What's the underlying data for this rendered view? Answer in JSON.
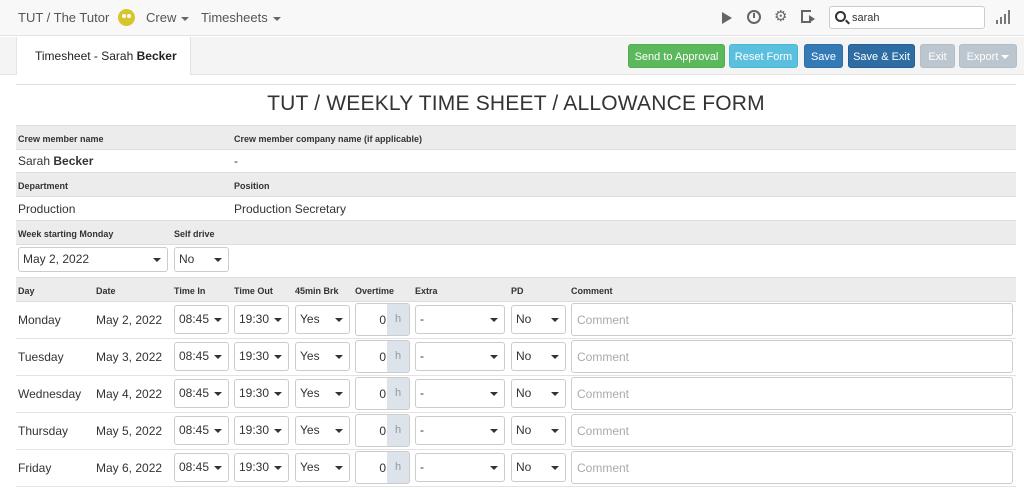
{
  "nav": {
    "brand": "TUT / The Tutor",
    "crew_label": "Crew",
    "timesheets_label": "Timesheets",
    "search_value": "sarah"
  },
  "subheader": {
    "title_prefix": "Timesheet - Sarah ",
    "title_bold": "Becker",
    "buttons": {
      "approval": "Send to Approval",
      "reset": "Reset Form",
      "save": "Save",
      "save_exit": "Save & Exit",
      "exit": "Exit",
      "export": "Export"
    }
  },
  "form": {
    "title": "TUT / WEEKLY TIME SHEET / ALLOWANCE FORM",
    "labels": {
      "crew_name": "Crew member name",
      "company": "Crew member company name (if applicable)",
      "department": "Department",
      "position": "Position",
      "week_start": "Week starting Monday",
      "self_drive": "Self drive"
    },
    "crew_first": "Sarah ",
    "crew_last": "Becker",
    "company": "-",
    "department": "Production",
    "position": "Production Secretary",
    "week_start": "May 2, 2022",
    "self_drive": "No"
  },
  "table": {
    "headers": {
      "day": "Day",
      "date": "Date",
      "time_in": "Time In",
      "time_out": "Time Out",
      "brk": "45min Brk",
      "overtime": "Overtime",
      "extra": "Extra",
      "pd": "PD",
      "comment": "Comment"
    },
    "overtime_unit": "h",
    "comment_placeholder": "Comment",
    "rows": [
      {
        "day": "Monday",
        "date": "May 2, 2022",
        "time_in": "08:45",
        "time_out": "19:30",
        "brk": "Yes",
        "overtime": "0",
        "extra": "-",
        "pd": "No"
      },
      {
        "day": "Tuesday",
        "date": "May 3, 2022",
        "time_in": "08:45",
        "time_out": "19:30",
        "brk": "Yes",
        "overtime": "0",
        "extra": "-",
        "pd": "No"
      },
      {
        "day": "Wednesday",
        "date": "May 4, 2022",
        "time_in": "08:45",
        "time_out": "19:30",
        "brk": "Yes",
        "overtime": "0",
        "extra": "-",
        "pd": "No"
      },
      {
        "day": "Thursday",
        "date": "May 5, 2022",
        "time_in": "08:45",
        "time_out": "19:30",
        "brk": "Yes",
        "overtime": "0",
        "extra": "-",
        "pd": "No"
      },
      {
        "day": "Friday",
        "date": "May 6, 2022",
        "time_in": "08:45",
        "time_out": "19:30",
        "brk": "Yes",
        "overtime": "0",
        "extra": "-",
        "pd": "No"
      }
    ]
  }
}
